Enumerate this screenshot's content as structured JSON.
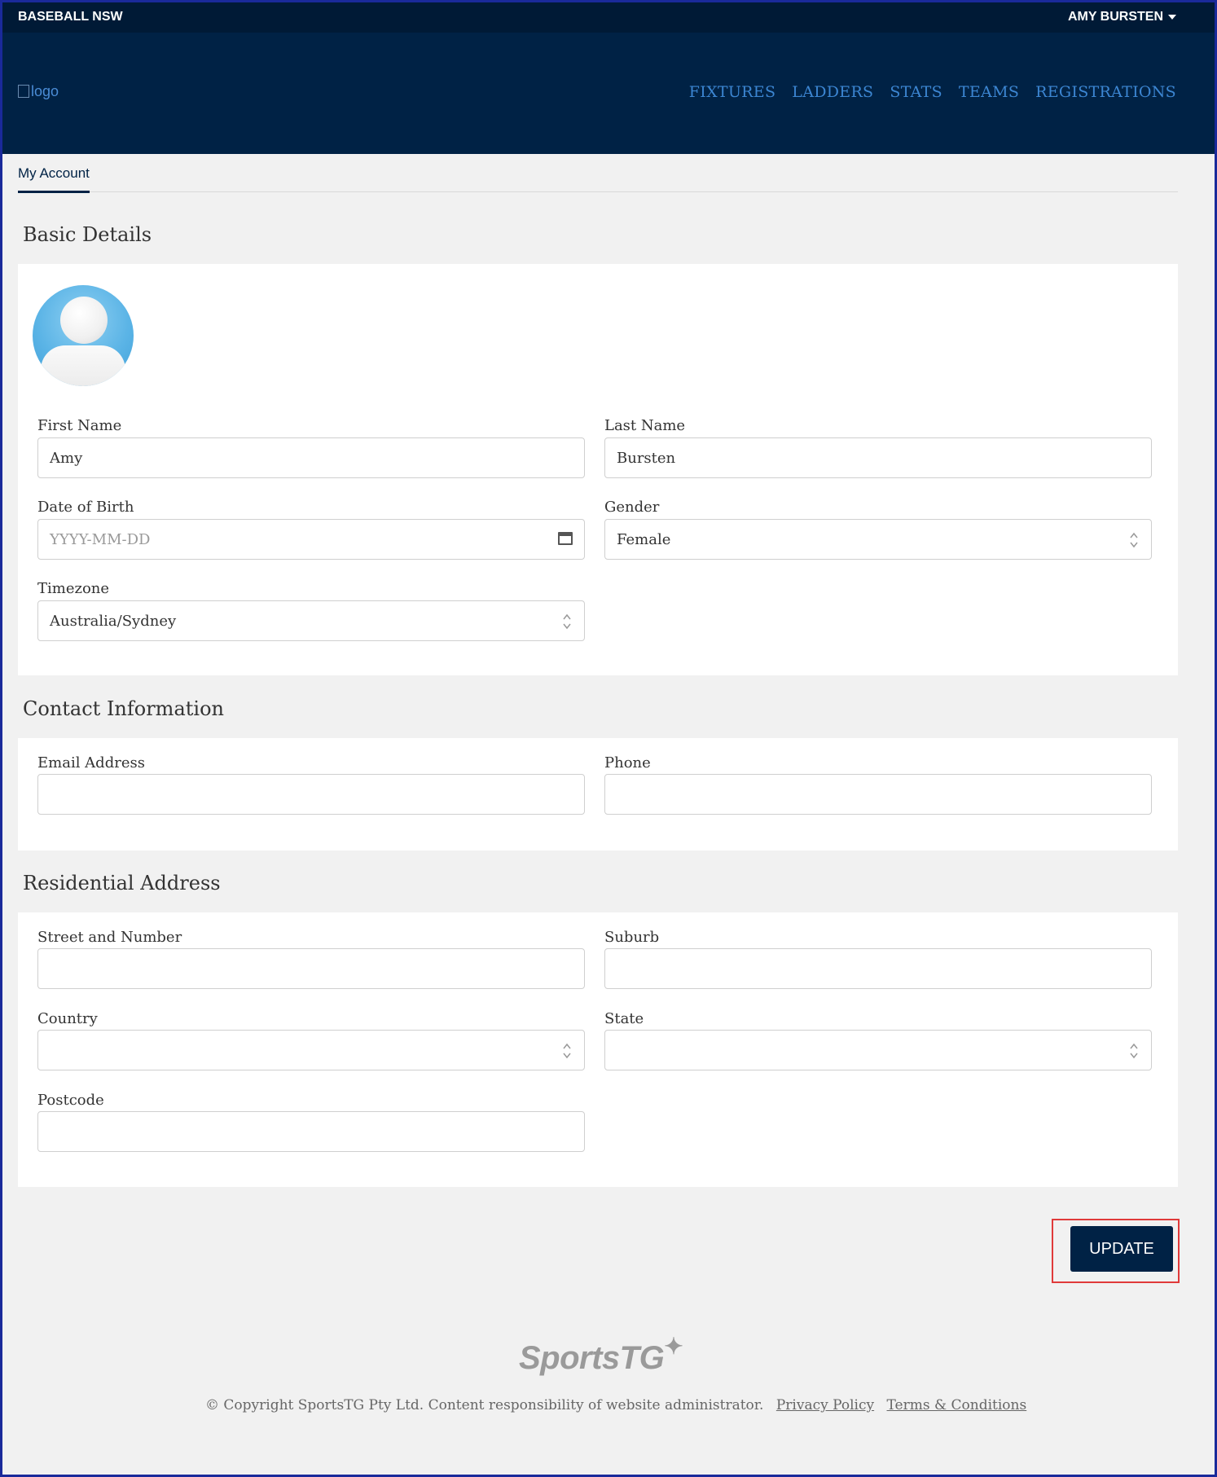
{
  "topbar": {
    "org": "BASEBALL NSW",
    "user": "AMY BURSTEN"
  },
  "header": {
    "logo_alt": "logo",
    "nav": [
      "FIXTURES",
      "LADDERS",
      "STATS",
      "TEAMS",
      "REGISTRATIONS"
    ]
  },
  "tabs": {
    "active": "My Account"
  },
  "basic": {
    "title": "Basic Details",
    "first_name": {
      "label": "First Name",
      "value": "Amy"
    },
    "last_name": {
      "label": "Last Name",
      "value": "Bursten"
    },
    "dob": {
      "label": "Date of Birth",
      "placeholder": "YYYY-MM-DD"
    },
    "gender": {
      "label": "Gender",
      "value": "Female"
    },
    "timezone": {
      "label": "Timezone",
      "value": "Australia/Sydney"
    }
  },
  "contact": {
    "title": "Contact Information",
    "email": {
      "label": "Email Address",
      "value": ""
    },
    "phone": {
      "label": "Phone",
      "value": ""
    }
  },
  "address": {
    "title": "Residential Address",
    "street": {
      "label": "Street and Number",
      "value": ""
    },
    "suburb": {
      "label": "Suburb",
      "value": ""
    },
    "country": {
      "label": "Country",
      "value": ""
    },
    "state": {
      "label": "State",
      "value": ""
    },
    "postcode": {
      "label": "Postcode",
      "value": ""
    }
  },
  "actions": {
    "update": "UPDATE"
  },
  "footer": {
    "brand": "SportsTG",
    "copyright": "© Copyright SportsTG Pty Ltd. Content responsibility of website administrator.",
    "privacy": "Privacy Policy",
    "terms": "Terms & Conditions"
  },
  "colors": {
    "navy": "#002245",
    "topbar": "#001a36",
    "link": "#3c86d2",
    "highlight": "#e03a3a"
  }
}
